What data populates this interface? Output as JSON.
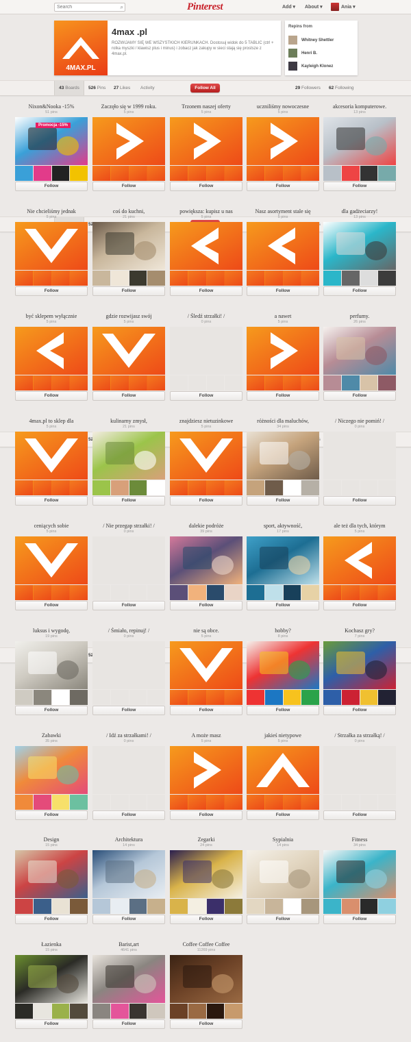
{
  "topbar": {
    "search_placeholder": "Search",
    "logo": "Pinterest",
    "add": "Add ▾",
    "about": "About ▾",
    "user": "Ania ▾"
  },
  "profile": {
    "name": "4max .pl",
    "logo_text": "4MAX.PL",
    "description": "ROZWIJAMY SIĘ WE WSZYSTKICH KIERUNKACH. Dostosuj widok do 5 TABLIC (ctrl + rolka myszki / klawisz plus i minus) i zobacz jak zakupy w sieci stają się prostsze z 4max.pl."
  },
  "repins": {
    "title": "Repins from",
    "users": [
      "Whitney Shettler",
      "Henri B.",
      "Kayleigh Klonez"
    ]
  },
  "tabbar": {
    "boards": "43",
    "boards_label": "Boards",
    "pins": "526",
    "pins_label": "Pins",
    "likes": "27",
    "likes_label": "Likes",
    "activity": "Activity",
    "follow_all": "Follow All",
    "followers": "29",
    "followers_label": "Followers",
    "following": "62",
    "following_label": "Following"
  },
  "follow_label": "Follow",
  "colors": {
    "brand_red": "#c8232c",
    "orange_start": "#f69a1d",
    "orange_end": "#ee4a18",
    "background": "#ece9e7"
  },
  "boards": [
    {
      "title": "Nixon&Nooka -15%",
      "count": "51 pins",
      "cover": "photo",
      "photo": "promo",
      "promo_text": "Promocja -15%"
    },
    {
      "title": "Zaczęło się w 1999 roku.",
      "count": "5 pins",
      "cover": "arrow-right"
    },
    {
      "title": "Trzonem naszej oferty",
      "count": "5 pins",
      "cover": "arrow-right"
    },
    {
      "title": "uczniliśmy nowoczesne",
      "count": "5 pins",
      "cover": "arrow-right"
    },
    {
      "title": "akcesoria komputerowe.",
      "count": "13 pins",
      "cover": "photo",
      "photo": "cables"
    },
    {
      "title": "Nie chcieliśmy jednak",
      "count": "5 pins",
      "cover": "arrow-down"
    },
    {
      "title": "coś do kuchni,",
      "count": "21 pins",
      "cover": "photo",
      "photo": "kitchen"
    },
    {
      "title": "powiększa: kupisz u nas",
      "count": "5 pins",
      "cover": "arrow-left"
    },
    {
      "title": "Nasz asortyment stale się",
      "count": "5 pins",
      "cover": "arrow-left"
    },
    {
      "title": "dla gadżeciarzy!",
      "count": "13 pins",
      "cover": "photo",
      "photo": "ipad"
    },
    {
      "title": "być sklepem wyłącznie",
      "count": "5 pins",
      "cover": "arrow-left"
    },
    {
      "title": "gdzie rozwijasz swój",
      "count": "5 pins",
      "cover": "arrow-down"
    },
    {
      "title": "/ Śledź strzałki! /",
      "count": "0 pins",
      "cover": "empty"
    },
    {
      "title": "a nawet",
      "count": "5 pins",
      "cover": "arrow-right"
    },
    {
      "title": "perfumy.",
      "count": "26 pins",
      "cover": "photo",
      "photo": "perfume"
    },
    {
      "title": "4max.pl to sklep dla",
      "count": "5 pins",
      "cover": "arrow-down"
    },
    {
      "title": "kulinarny zmysł,",
      "count": "21 pins",
      "cover": "photo",
      "photo": "food"
    },
    {
      "title": "znajdziesz nietuzinkowe",
      "count": "5 pins",
      "cover": "arrow-down"
    },
    {
      "title": "różności dla maluchów,",
      "count": "34 pins",
      "cover": "photo",
      "photo": "kids"
    },
    {
      "title": "/ Niczego nie pomiń! /",
      "count": "0 pins",
      "cover": "empty"
    },
    {
      "title": "ceniących sobie",
      "count": "5 pins",
      "cover": "arrow-down"
    },
    {
      "title": "/ Nie przegap strzałki! /",
      "count": "0 pins",
      "cover": "empty"
    },
    {
      "title": "dalekie podróże",
      "count": "39 pins",
      "cover": "photo",
      "photo": "travel"
    },
    {
      "title": "sport, aktywność,",
      "count": "17 pins",
      "cover": "photo",
      "photo": "sport"
    },
    {
      "title": "ale też dla tych, którym",
      "count": "5 pins",
      "cover": "arrow-left"
    },
    {
      "title": "luksus i wygodę,",
      "count": "19 pins",
      "cover": "photo",
      "photo": "interior"
    },
    {
      "title": "/ Śmiało, repinuj! /",
      "count": "0 pins",
      "cover": "empty"
    },
    {
      "title": "nie są obce.",
      "count": "5 pins",
      "cover": "arrow-down"
    },
    {
      "title": "hobby?",
      "count": "8 pins",
      "cover": "photo",
      "photo": "hobby"
    },
    {
      "title": "Kochasz gry?",
      "count": "7 pins",
      "cover": "photo",
      "photo": "games"
    },
    {
      "title": "Zabawki",
      "count": "35 pins",
      "cover": "photo",
      "photo": "toys"
    },
    {
      "title": "/ Idź za strzałkami! /",
      "count": "0 pins",
      "cover": "empty"
    },
    {
      "title": "A może masz",
      "count": "5 pins",
      "cover": "arrow-right"
    },
    {
      "title": "jakieś nietypowe",
      "count": "5 pins",
      "cover": "arrow-up"
    },
    {
      "title": "/ Strzałka za strzałką! /",
      "count": "0 pins",
      "cover": "empty"
    },
    {
      "title": "Design",
      "count": "15 pins",
      "cover": "photo",
      "photo": "design"
    },
    {
      "title": "Architektura",
      "count": "14 pins",
      "cover": "photo",
      "photo": "architecture"
    },
    {
      "title": "Zegarki",
      "count": "24 pins",
      "cover": "photo",
      "photo": "watch"
    },
    {
      "title": "Sypialnia",
      "count": "14 pins",
      "cover": "photo",
      "photo": "bedroom"
    },
    {
      "title": "Fitness",
      "count": "34 pins",
      "cover": "photo",
      "photo": "fitness"
    },
    {
      "title": "Łazienka",
      "count": "15 pins",
      "cover": "photo",
      "photo": "bathroom"
    },
    {
      "title": "Barist,art",
      "count": "4641 pins",
      "cover": "photo",
      "photo": "coffee-art"
    },
    {
      "title": "Coffee Coffee Coffee",
      "count": "11269 pins",
      "cover": "photo",
      "photo": "beans"
    }
  ]
}
